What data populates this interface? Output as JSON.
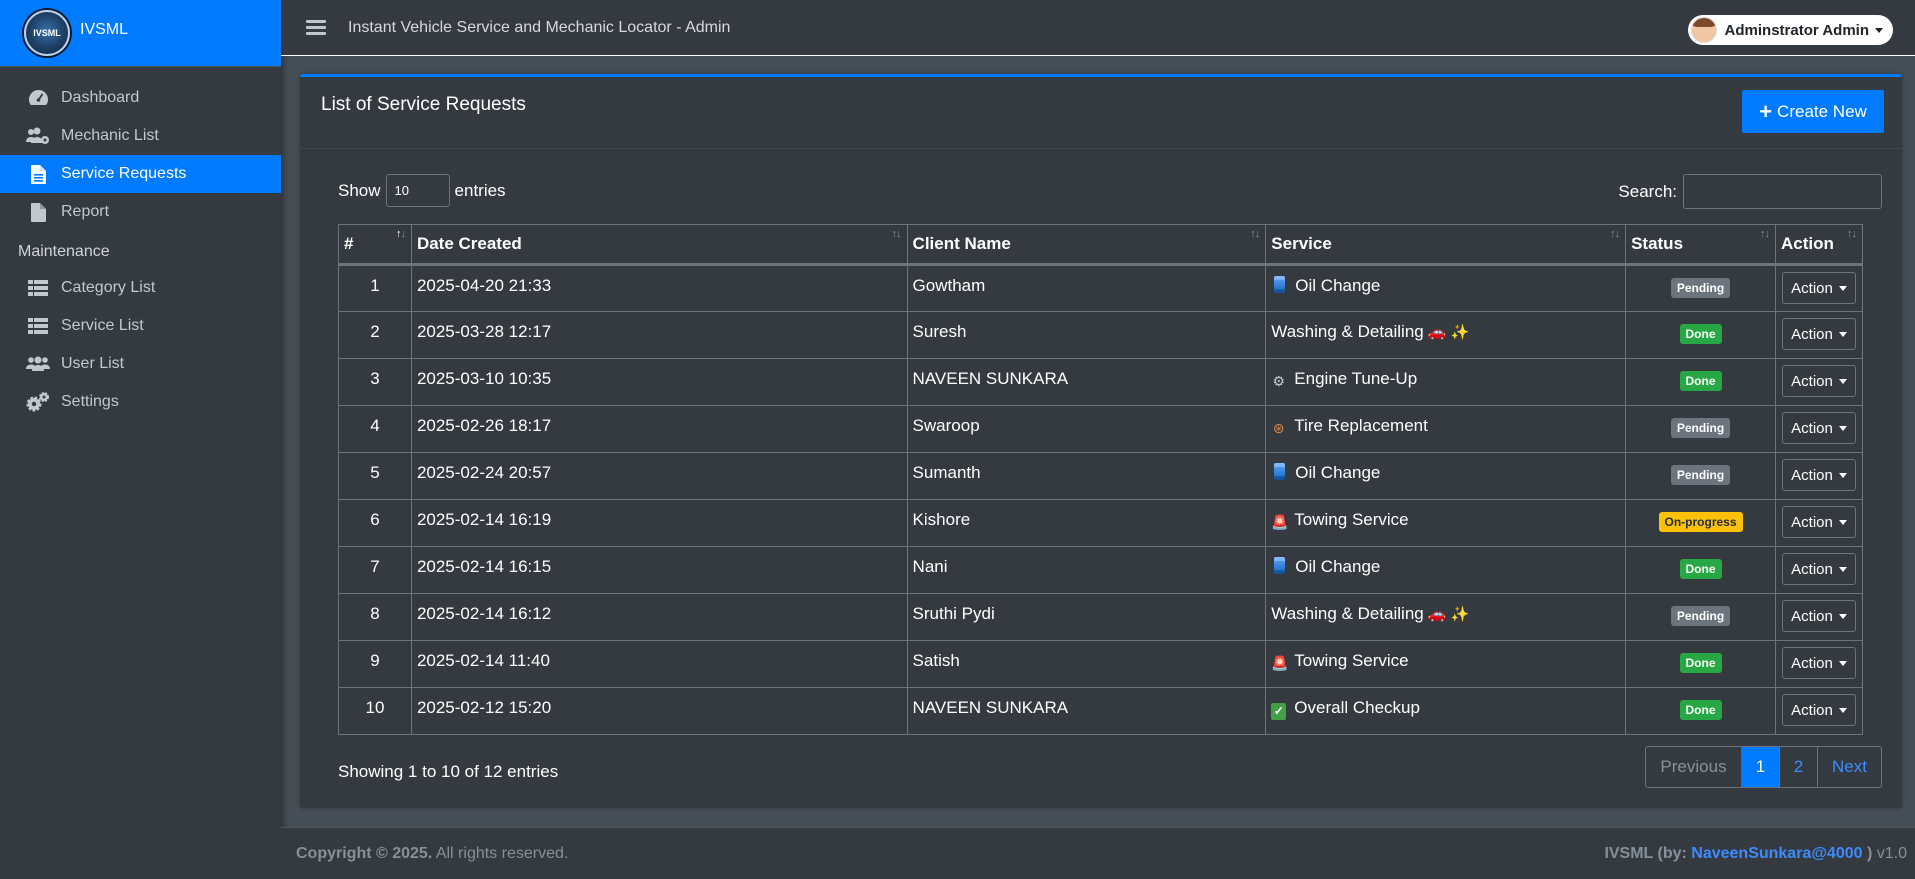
{
  "brand": {
    "logo_text": "IVSML",
    "name": "IVSML"
  },
  "sidebar": {
    "items": [
      {
        "label": "Dashboard"
      },
      {
        "label": "Mechanic List"
      },
      {
        "label": "Service Requests"
      },
      {
        "label": "Report"
      }
    ],
    "section_header": "Maintenance",
    "maintenance_items": [
      {
        "label": "Category List"
      },
      {
        "label": "Service List"
      },
      {
        "label": "User List"
      },
      {
        "label": "Settings"
      }
    ]
  },
  "topbar": {
    "title": "Instant Vehicle Service and Mechanic Locator - Admin",
    "user_name": "Adminstrator Admin"
  },
  "card": {
    "title": "List of Service Requests",
    "create_label": "Create New",
    "show_label": "Show",
    "entries_value": "10",
    "entries_label": "entries",
    "search_label": "Search:"
  },
  "table": {
    "headers": [
      "#",
      "Date Created",
      "Client Name",
      "Service",
      "Status",
      "Action"
    ],
    "rows": [
      {
        "num": "1",
        "date": "2025-04-20 21:33",
        "client": "Gowtham",
        "service": "Oil Change",
        "icon": "oil",
        "status": "Pending",
        "action": "Action"
      },
      {
        "num": "2",
        "date": "2025-03-28 12:17",
        "client": "Suresh",
        "service": "Washing & Detailing",
        "icon": "wash",
        "status": "Done",
        "action": "Action"
      },
      {
        "num": "3",
        "date": "2025-03-10 10:35",
        "client": "NAVEEN SUNKARA",
        "service": "Engine Tune-Up",
        "icon": "gear",
        "status": "Done",
        "action": "Action"
      },
      {
        "num": "4",
        "date": "2025-02-26 18:17",
        "client": "Swaroop",
        "service": "Tire Replacement",
        "icon": "tire",
        "status": "Pending",
        "action": "Action"
      },
      {
        "num": "5",
        "date": "2025-02-24 20:57",
        "client": "Sumanth",
        "service": "Oil Change",
        "icon": "oil",
        "status": "Pending",
        "action": "Action"
      },
      {
        "num": "6",
        "date": "2025-02-14 16:19",
        "client": "Kishore",
        "service": "Towing Service",
        "icon": "tow",
        "status": "On-progress",
        "action": "Action"
      },
      {
        "num": "7",
        "date": "2025-02-14 16:15",
        "client": "Nani",
        "service": "Oil Change",
        "icon": "oil",
        "status": "Done",
        "action": "Action"
      },
      {
        "num": "8",
        "date": "2025-02-14 16:12",
        "client": "Sruthi Pydi",
        "service": "Washing & Detailing",
        "icon": "wash",
        "status": "Pending",
        "action": "Action"
      },
      {
        "num": "9",
        "date": "2025-02-14 11:40",
        "client": "Satish",
        "service": "Towing Service",
        "icon": "tow",
        "status": "Done",
        "action": "Action"
      },
      {
        "num": "10",
        "date": "2025-02-12 15:20",
        "client": "NAVEEN SUNKARA",
        "service": "Overall Checkup",
        "icon": "check",
        "status": "Done",
        "action": "Action"
      }
    ]
  },
  "pagination": {
    "info": "Showing 1 to 10 of 12 entries",
    "previous": "Previous",
    "page1": "1",
    "page2": "2",
    "next": "Next"
  },
  "footer": {
    "copyright_bold": "Copyright © 2025.",
    "copyright_rest": " All rights reserved.",
    "credit_prefix": "IVSML (by: ",
    "credit_link": "NaveenSunkara@4000",
    "credit_suffix": " )",
    "version": " v1.0"
  },
  "colors": {
    "accent": "#007bff",
    "sidebar_bg": "#343a40",
    "page_bg": "#454d55",
    "done": "#28a745",
    "pending": "#6c757d",
    "progress": "#ffc107"
  }
}
